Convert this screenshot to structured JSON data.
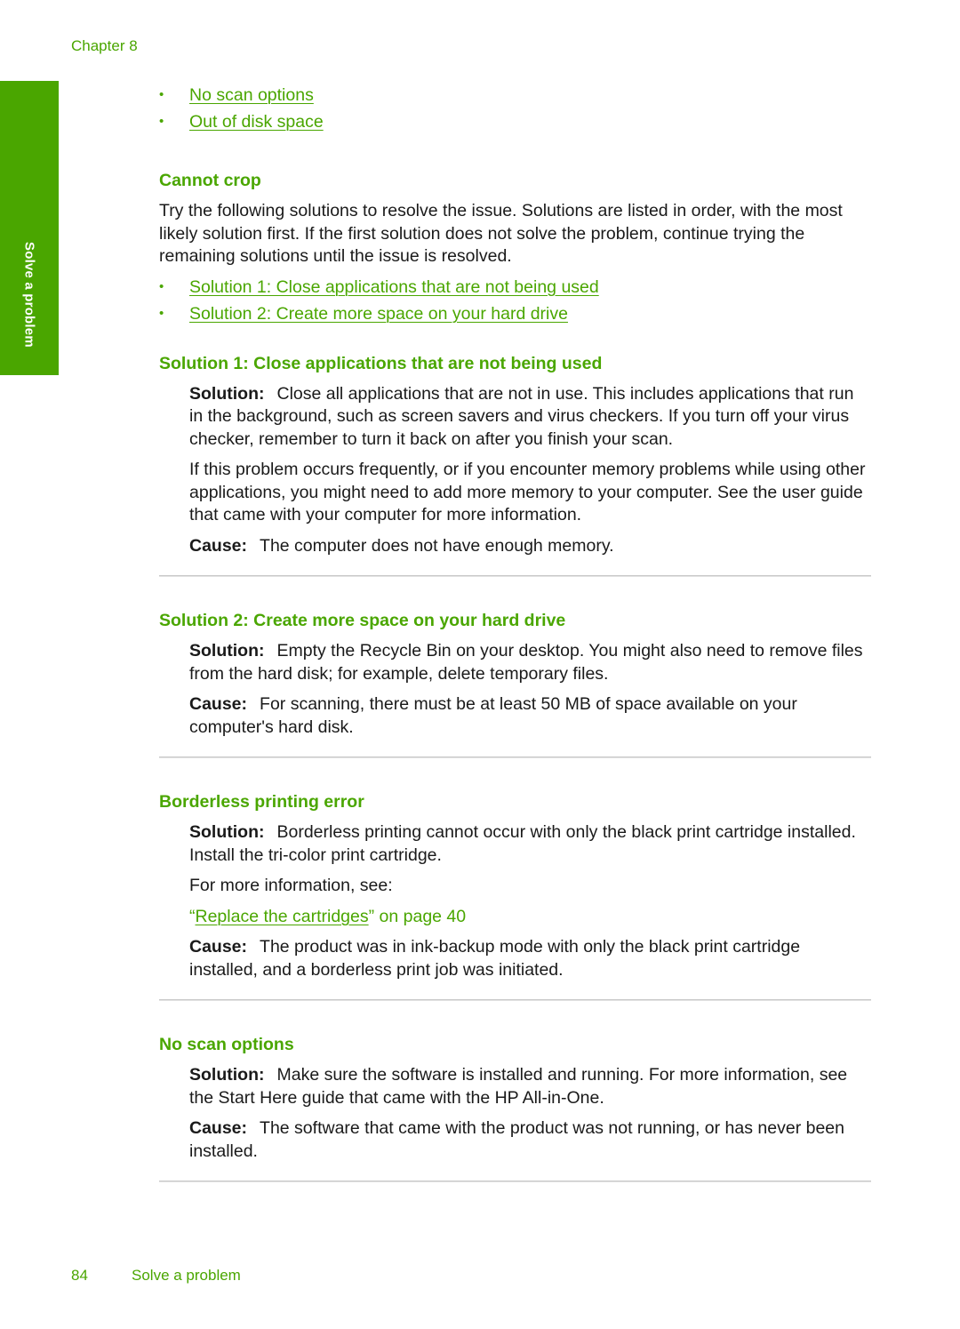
{
  "header": {
    "chapter": "Chapter 8"
  },
  "side_tab": {
    "label": "Solve a problem"
  },
  "top_links": [
    "No scan options",
    "Out of disk space"
  ],
  "cannot_crop": {
    "heading": "Cannot crop",
    "intro": "Try the following solutions to resolve the issue. Solutions are listed in order, with the most likely solution first. If the first solution does not solve the problem, continue trying the remaining solutions until the issue is resolved.",
    "links": [
      "Solution 1: Close applications that are not being used",
      "Solution 2: Create more space on your hard drive"
    ]
  },
  "solution1": {
    "heading": "Solution 1: Close applications that are not being used",
    "solution_label": "Solution:",
    "solution_text": "Close all applications that are not in use. This includes applications that run in the background, such as screen savers and virus checkers. If you turn off your virus checker, remember to turn it back on after you finish your scan.",
    "extra": "If this problem occurs frequently, or if you encounter memory problems while using other applications, you might need to add more memory to your computer. See the user guide that came with your computer for more information.",
    "cause_label": "Cause:",
    "cause_text": "The computer does not have enough memory."
  },
  "solution2": {
    "heading": "Solution 2: Create more space on your hard drive",
    "solution_label": "Solution:",
    "solution_text": "Empty the Recycle Bin on your desktop. You might also need to remove files from the hard disk; for example, delete temporary files.",
    "cause_label": "Cause:",
    "cause_text": "For scanning, there must be at least 50 MB of space available on your computer's hard disk."
  },
  "borderless": {
    "heading": "Borderless printing error",
    "solution_label": "Solution:",
    "solution_text": "Borderless printing cannot occur with only the black print cartridge installed. Install the tri-color print cartridge.",
    "more_info": "For more information, see:",
    "ref_open_quote": "“",
    "ref_link": "Replace the cartridges",
    "ref_suffix": "” on page 40",
    "cause_label": "Cause:",
    "cause_text": "The product was in ink-backup mode with only the black print cartridge installed, and a borderless print job was initiated."
  },
  "no_scan": {
    "heading": "No scan options",
    "solution_label": "Solution:",
    "solution_text": "Make sure the software is installed and running. For more information, see the Start Here guide that came with the HP All-in-One.",
    "cause_label": "Cause:",
    "cause_text": "The software that came with the product was not running, or has never been installed."
  },
  "footer": {
    "page_number": "84",
    "section": "Solve a problem"
  },
  "colors": {
    "accent": "#4aa600",
    "text": "#1a1a1a",
    "rule": "#c8c8c8"
  },
  "icons": {
    "bullet": "bullet-dot"
  }
}
